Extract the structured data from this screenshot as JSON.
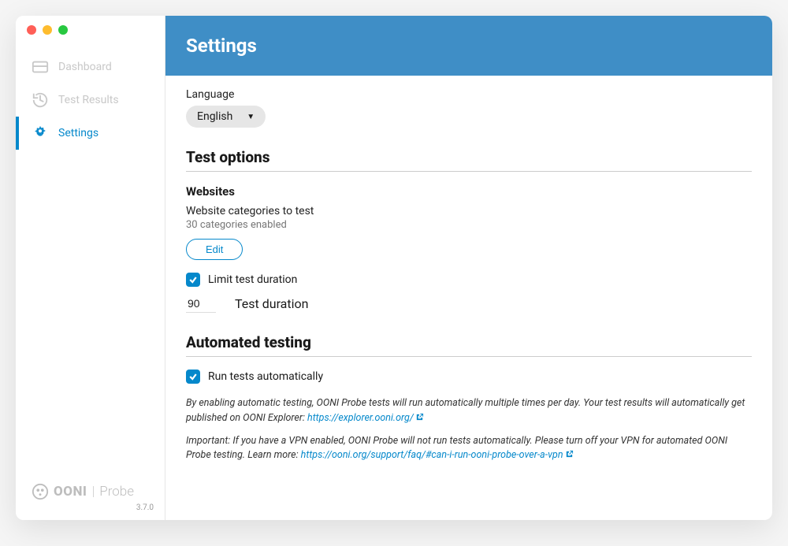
{
  "sidebar": {
    "items": [
      {
        "label": "Dashboard"
      },
      {
        "label": "Test Results"
      },
      {
        "label": "Settings"
      }
    ],
    "brand_ooni": "OONI",
    "brand_probe": "Probe",
    "version": "3.7.0"
  },
  "header": {
    "title": "Settings"
  },
  "language": {
    "label": "Language",
    "value": "English"
  },
  "test_options": {
    "title": "Test options",
    "websites": {
      "title": "Websites",
      "categories_label": "Website categories to test",
      "categories_count": "30 categories enabled",
      "edit": "Edit",
      "limit_label": "Limit test duration",
      "limit_checked": true,
      "duration_value": "90",
      "duration_label": "Test duration"
    }
  },
  "automated": {
    "title": "Automated testing",
    "run_label": "Run tests automatically",
    "run_checked": true,
    "note1_pre": "By enabling automatic testing, OONI Probe tests will run automatically multiple times per day. Your test results will automatically get published on OONI Explorer: ",
    "note1_link": "https://explorer.ooni.org/",
    "note2_pre": "Important: If you have a VPN enabled, OONI Probe will not run tests automatically. Please turn off your VPN for automated OONI Probe testing. Learn more: ",
    "note2_link": "https://ooni.org/support/faq/#can-i-run-ooni-probe-over-a-vpn"
  }
}
